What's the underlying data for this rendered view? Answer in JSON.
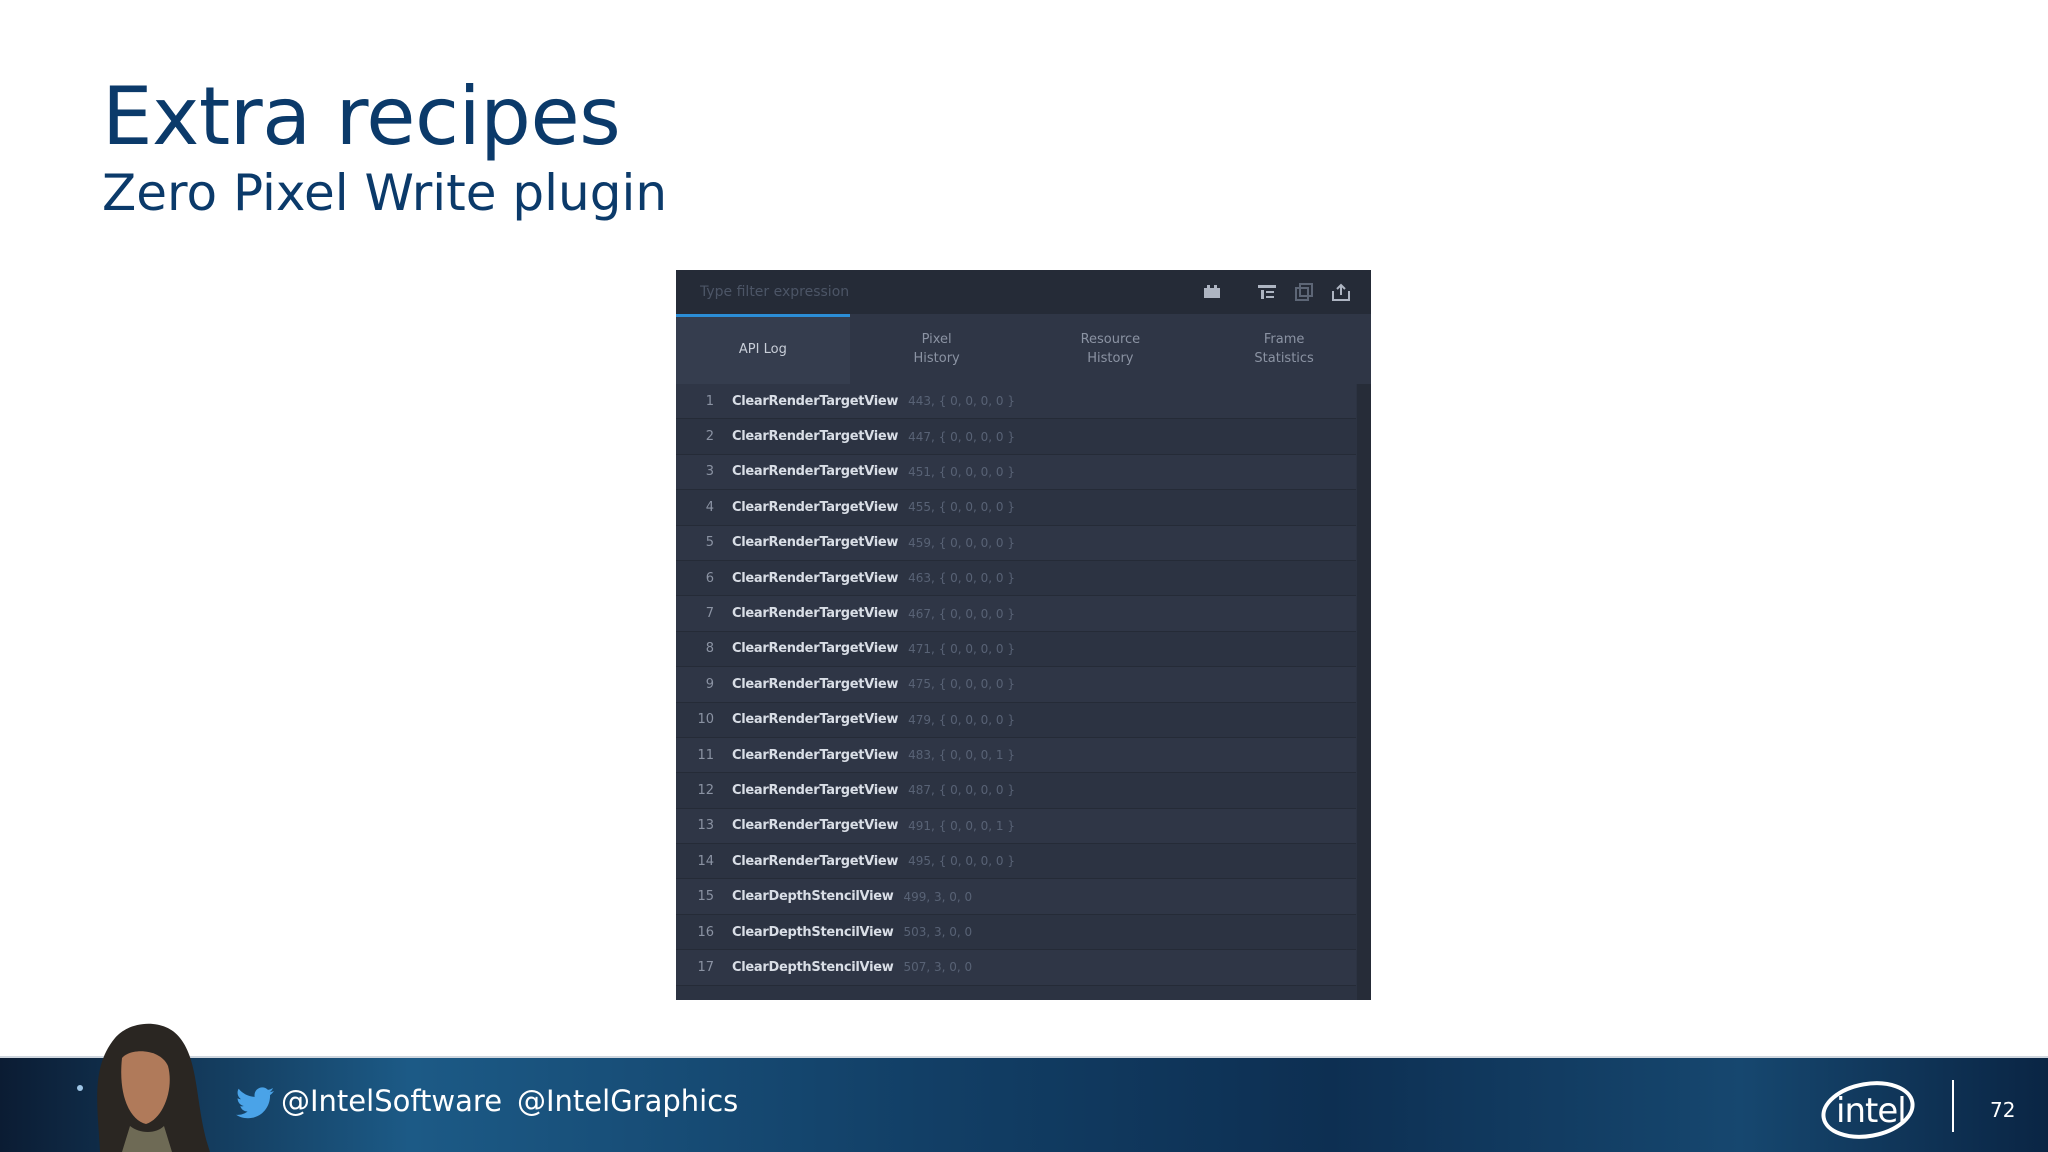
{
  "slide": {
    "title": "Extra recipes",
    "subtitle": "Zero Pixel Write plugin",
    "page_number": "72"
  },
  "panel": {
    "filter_placeholder": "Type filter expression",
    "toolbar_icons": [
      "toggle-icon",
      "filter-tree-icon",
      "copy-icon",
      "export-icon"
    ],
    "tabs": [
      {
        "label": "API Log",
        "active": true
      },
      {
        "label": "Pixel\nHistory",
        "active": false
      },
      {
        "label": "Resource\nHistory",
        "active": false
      },
      {
        "label": "Frame\nStatistics",
        "active": false
      }
    ],
    "rows": [
      {
        "index": "1",
        "call": "ClearRenderTargetView",
        "args": "443, { 0, 0, 0, 0 }"
      },
      {
        "index": "2",
        "call": "ClearRenderTargetView",
        "args": "447, { 0, 0, 0, 0 }"
      },
      {
        "index": "3",
        "call": "ClearRenderTargetView",
        "args": "451, { 0, 0, 0, 0 }"
      },
      {
        "index": "4",
        "call": "ClearRenderTargetView",
        "args": "455, { 0, 0, 0, 0 }"
      },
      {
        "index": "5",
        "call": "ClearRenderTargetView",
        "args": "459, { 0, 0, 0, 0 }"
      },
      {
        "index": "6",
        "call": "ClearRenderTargetView",
        "args": "463, { 0, 0, 0, 0 }"
      },
      {
        "index": "7",
        "call": "ClearRenderTargetView",
        "args": "467, { 0, 0, 0, 0 }"
      },
      {
        "index": "8",
        "call": "ClearRenderTargetView",
        "args": "471, { 0, 0, 0, 0 }"
      },
      {
        "index": "9",
        "call": "ClearRenderTargetView",
        "args": "475, { 0, 0, 0, 0 }"
      },
      {
        "index": "10",
        "call": "ClearRenderTargetView",
        "args": "479, { 0, 0, 0, 0 }"
      },
      {
        "index": "11",
        "call": "ClearRenderTargetView",
        "args": "483, { 0, 0, 0, 1 }"
      },
      {
        "index": "12",
        "call": "ClearRenderTargetView",
        "args": "487, { 0, 0, 0, 0 }"
      },
      {
        "index": "13",
        "call": "ClearRenderTargetView",
        "args": "491, { 0, 0, 0, 1 }"
      },
      {
        "index": "14",
        "call": "ClearRenderTargetView",
        "args": "495, { 0, 0, 0, 0 }"
      },
      {
        "index": "15",
        "call": "ClearDepthStencilView",
        "args": "499, 3, 0, 0"
      },
      {
        "index": "16",
        "call": "ClearDepthStencilView",
        "args": "503, 3, 0, 0"
      },
      {
        "index": "17",
        "call": "ClearDepthStencilView",
        "args": "507, 3, 0, 0"
      }
    ]
  },
  "footer": {
    "handles": [
      "@IntelSoftware",
      "@IntelGraphics"
    ],
    "logo_text": "intel"
  }
}
